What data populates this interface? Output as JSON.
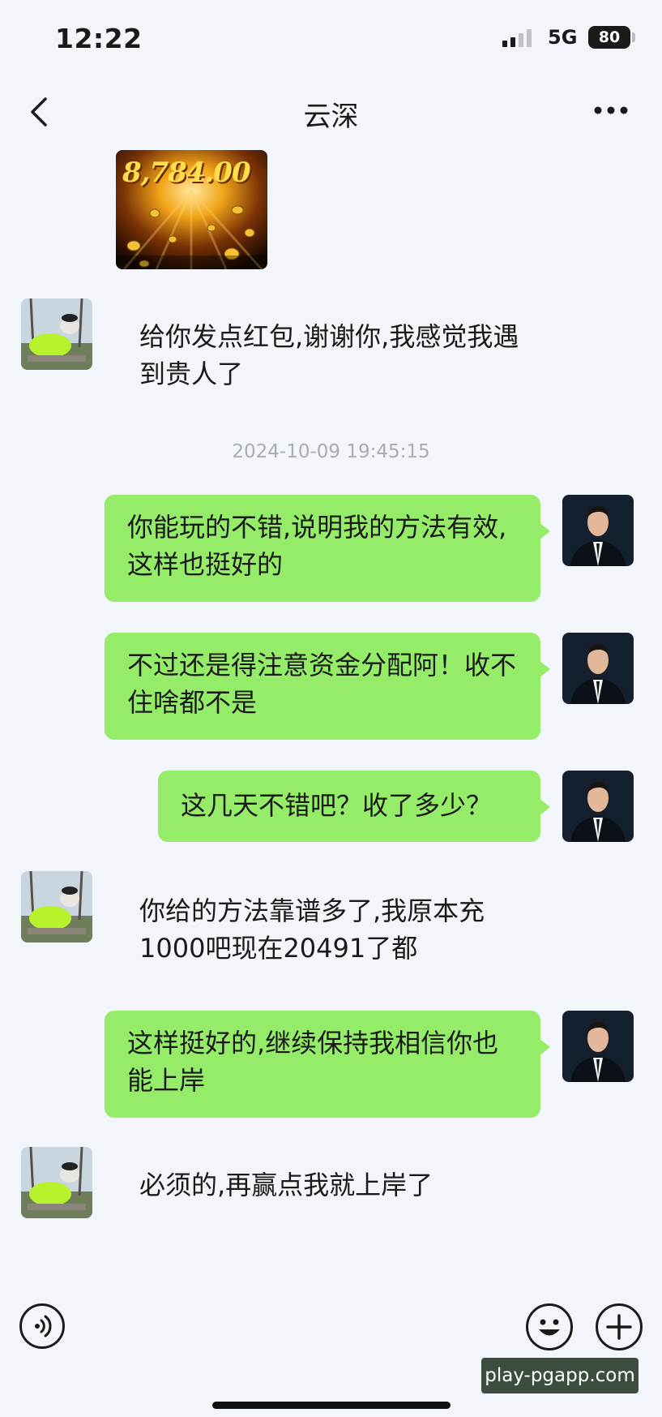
{
  "status": {
    "time": "12:22",
    "network": "5G",
    "battery": "80"
  },
  "header": {
    "title": "云深"
  },
  "image_message": {
    "amount": "8,784.00"
  },
  "messages": [
    {
      "side": "in",
      "text": "给你发点红包,谢谢你,我感觉我遇到贵人了"
    },
    {
      "side": "out",
      "text": "你能玩的不错,说明我的方法有效,这样也挺好的"
    },
    {
      "side": "out",
      "text": "不过还是得注意资金分配阿！收不住啥都不是"
    },
    {
      "side": "out",
      "text": "这几天不错吧？收了多少？"
    },
    {
      "side": "in",
      "text": "你给的方法靠谱多了,我原本充1000吧现在20491了都"
    },
    {
      "side": "out",
      "text": "这样挺好的,继续保持我相信你也能上岸"
    },
    {
      "side": "in",
      "text": "必须的,再赢点我就上岸了"
    }
  ],
  "timestamp": "2024-10-09 19:45:15",
  "watermark": "play-pgapp.com",
  "icons": {
    "back": "chevron-left-icon",
    "more": "more-dots-icon",
    "voice": "voice-icon",
    "emoji": "emoji-icon",
    "add": "plus-icon"
  },
  "colors": {
    "outgoing_bubble": "#95ec69",
    "background": "#f2f6fa"
  }
}
